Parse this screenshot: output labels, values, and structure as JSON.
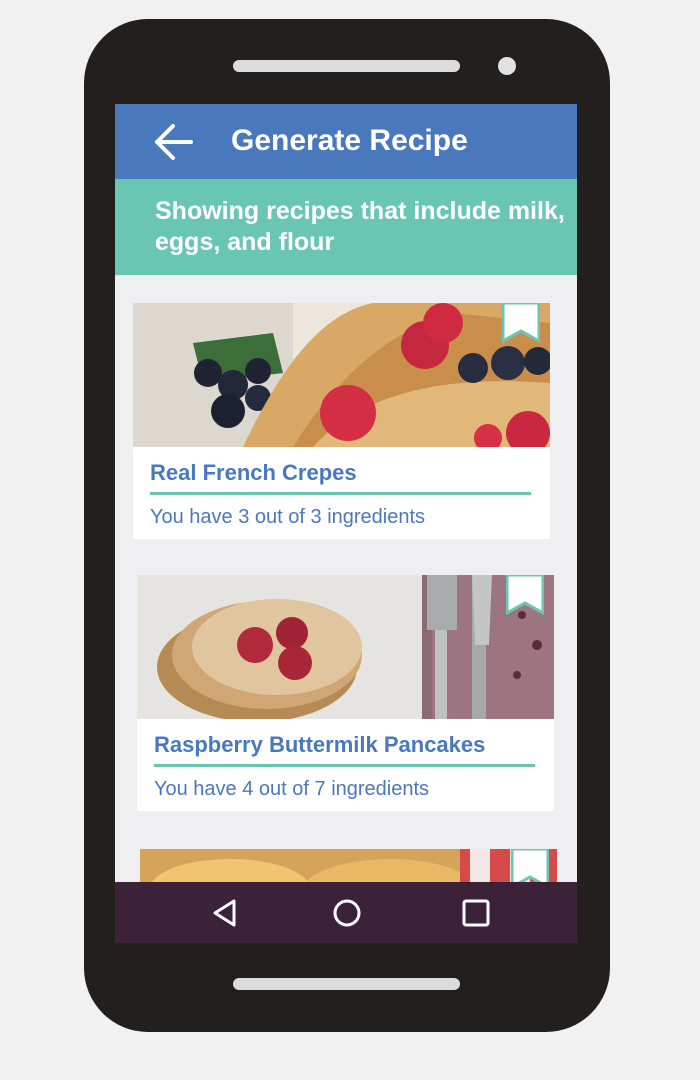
{
  "header": {
    "title": "Generate Recipe",
    "back_icon": "arrow-left-icon"
  },
  "banner": {
    "text": "Showing recipes that include milk, eggs, and flour"
  },
  "recipes": [
    {
      "title": "Real French Crepes",
      "subtitle": "You have 3 out of 3 ingredients",
      "bookmark_icon": "bookmark-icon"
    },
    {
      "title": "Raspberry Buttermilk Pancakes",
      "subtitle": "You have 4 out of 7 ingredients",
      "bookmark_icon": "bookmark-icon"
    },
    {
      "title": "",
      "subtitle": "",
      "bookmark_icon": "bookmark-icon"
    }
  ],
  "navbar": {
    "icons": [
      "back-triangle-icon",
      "home-circle-icon",
      "recents-square-icon"
    ]
  },
  "colors": {
    "appbar": "#4a78bd",
    "banner": "#68c6b3",
    "navbar": "#3b2239",
    "accent_text": "#4a78bd"
  }
}
